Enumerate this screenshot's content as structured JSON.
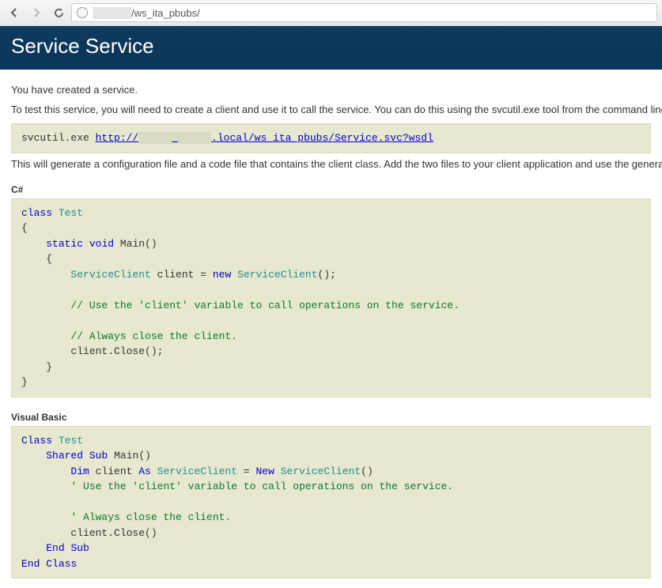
{
  "browser": {
    "url_prefix": "",
    "url_path": "/ws_ita_pbubs/"
  },
  "header": {
    "title": "Service Service"
  },
  "intro": {
    "line1": "You have created a service.",
    "line2": "To test this service, you will need to create a client and use it to call the service. You can do this using the svcutil.exe tool from the command line with the following syntax:"
  },
  "svcutil": {
    "cmd": "svcutil.exe ",
    "link_pre": "http://",
    "link_post": ".local/ws_ita_pbubs/Service.svc?wsdl"
  },
  "after": "This will generate a configuration file and a code file that contains the client class. Add the two files to your client application and use the generated client class to call the Service. For example:",
  "labels": {
    "csharp": "C#",
    "vb": "Visual Basic"
  },
  "csharp": {
    "l1a": "class",
    "l1b": "Test",
    "l2": "{",
    "l3a": "static",
    "l3b": "void",
    "l3c": "Main()",
    "l4": "{",
    "l5a": "ServiceClient",
    "l5b": "client = ",
    "l5c": "new",
    "l5d": "ServiceClient",
    "l5e": "();",
    "l6": "// Use the 'client' variable to call operations on the service.",
    "l7": "// Always close the client.",
    "l8": "client.Close();",
    "l9": "}",
    "l10": "}"
  },
  "vb": {
    "l1a": "Class",
    "l1b": "Test",
    "l2a": "Shared",
    "l2b": "Sub",
    "l2c": "Main()",
    "l3a": "Dim",
    "l3b": "client ",
    "l3c": "As",
    "l3d": "ServiceClient",
    "l3e": " = ",
    "l3f": "New",
    "l3g": "ServiceClient",
    "l3h": "()",
    "l4": "' Use the 'client' variable to call operations on the service.",
    "l5": "' Always close the client.",
    "l6": "client.Close()",
    "l7a": "End",
    "l7b": "Sub",
    "l8a": "End",
    "l8b": "Class"
  }
}
